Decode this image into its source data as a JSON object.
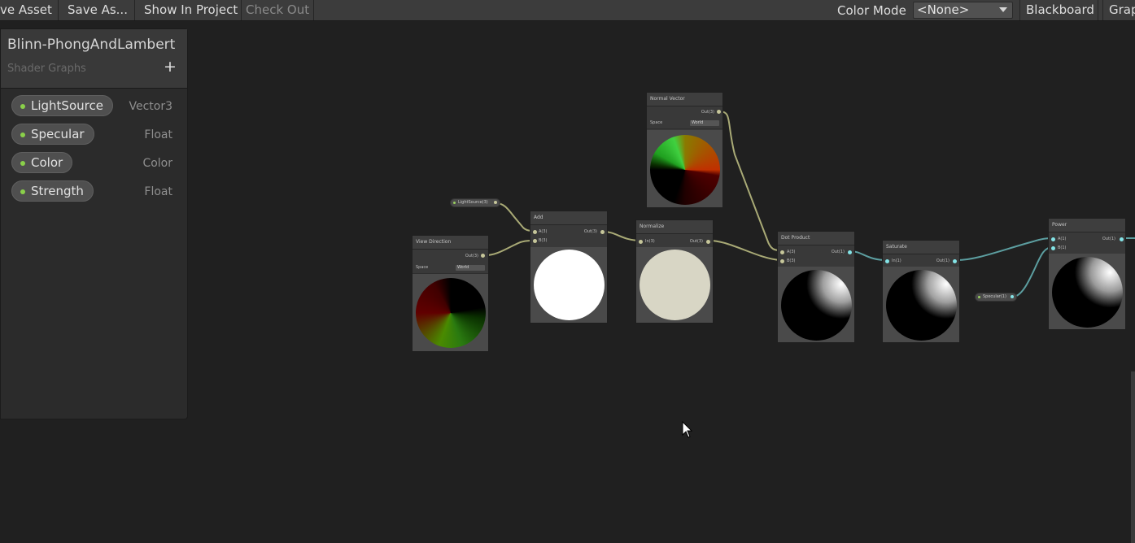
{
  "toolbar": {
    "save_asset": "ve Asset",
    "save_as": "Save As...",
    "show_in_project": "Show In Project",
    "check_out": "Check Out",
    "color_mode_label": "Color Mode",
    "color_mode_value": "<None>",
    "blackboard": "Blackboard",
    "graph": "Grap"
  },
  "blackboard": {
    "title": "Blinn-PhongAndLambert",
    "subtitle": "Shader Graphs",
    "add": "+",
    "properties": [
      {
        "name": "LightSource",
        "type": "Vector3"
      },
      {
        "name": "Specular",
        "type": "Float"
      },
      {
        "name": "Color",
        "type": "Color"
      },
      {
        "name": "Strength",
        "type": "Float"
      }
    ]
  },
  "nodes": {
    "normal_vector": {
      "title": "Normal Vector",
      "out": "Out(3)",
      "space_label": "Space",
      "space_value": "World"
    },
    "view_direction": {
      "title": "View Direction",
      "out": "Out(3)",
      "space_label": "Space",
      "space_value": "World"
    },
    "add": {
      "title": "Add",
      "in_a": "A(3)",
      "in_b": "B(3)",
      "out": "Out(3)"
    },
    "normalize": {
      "title": "Normalize",
      "in": "In(3)",
      "out": "Out(3)"
    },
    "dot_product": {
      "title": "Dot Product",
      "in_a": "A(3)",
      "in_b": "B(3)",
      "out": "Out(1)"
    },
    "saturate": {
      "title": "Saturate",
      "in": "In(1)",
      "out": "Out(1)"
    },
    "power": {
      "title": "Power",
      "in_a": "A(1)",
      "in_b": "B(1)",
      "out": "Out(1)"
    },
    "lightsource_prop": {
      "label": "LightSource(3)"
    },
    "specular_prop": {
      "label": "Specular(1)"
    }
  },
  "colors": {
    "vector3_wire": "#c6c69a",
    "float_wire": "#84e4e7",
    "accent_green": "#8ad04a"
  },
  "icons": [
    "mouse-cursor-icon",
    "dropdown-arrow-icon",
    "add-icon"
  ]
}
